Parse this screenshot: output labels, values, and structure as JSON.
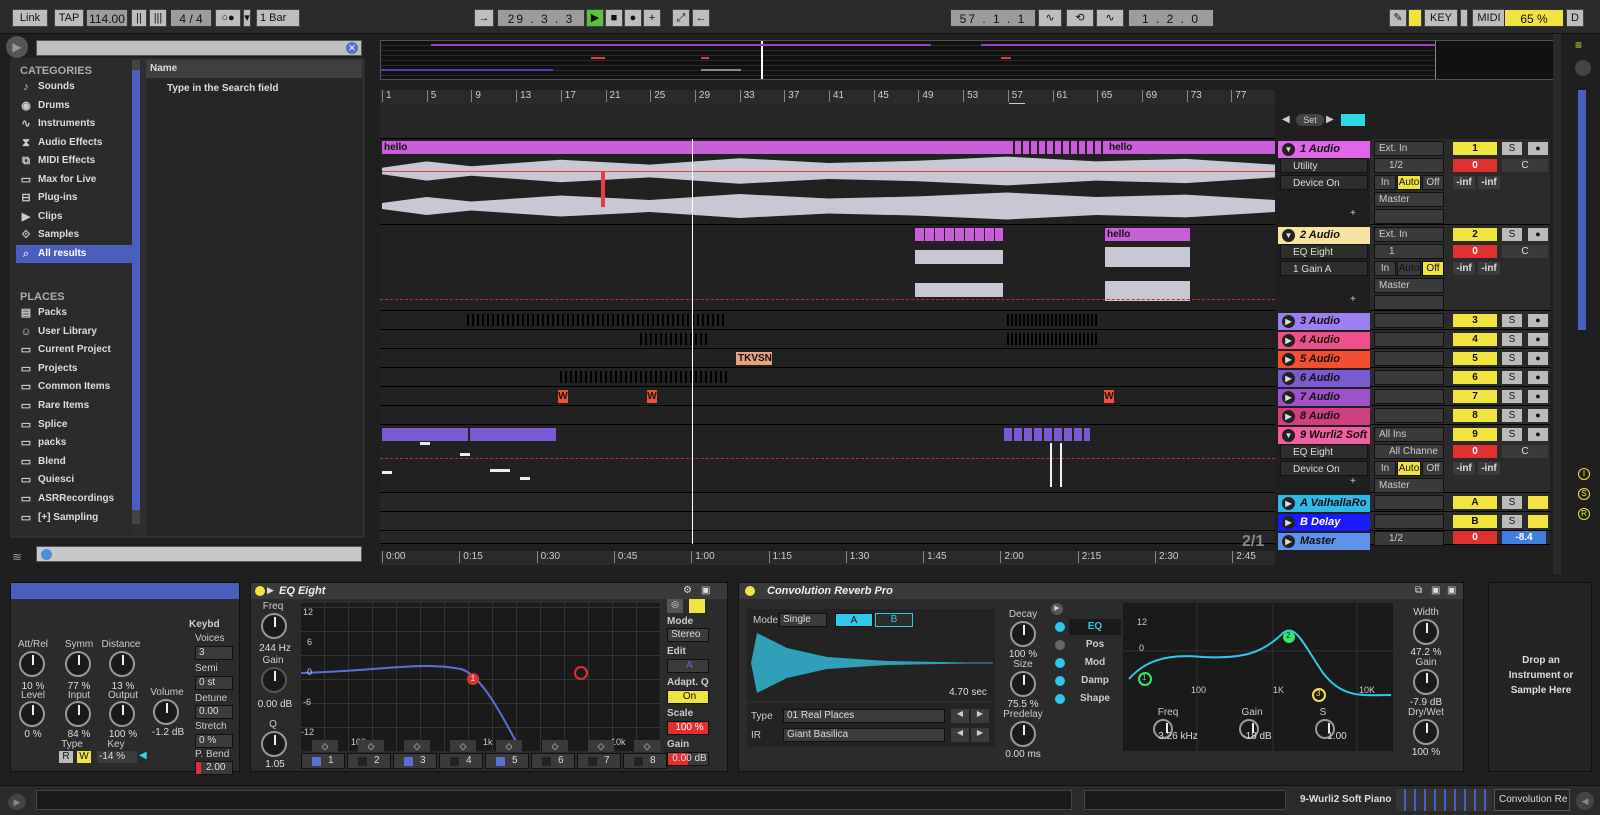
{
  "transport": {
    "link": "Link",
    "tap": "TAP",
    "tempo": "114.00",
    "signature": "4 / 4",
    "quantize": "1 Bar",
    "position": "29 .  3 .  3",
    "loop_start": "57 .  1 .  1",
    "loop_length": "1 .  2 .  0",
    "key": "KEY",
    "midi": "MIDI",
    "cpu": "65 %",
    "d": "D"
  },
  "browser": {
    "search_placeholder": "",
    "categories_title": "CATEGORIES",
    "name_header": "Name",
    "hint": "Type in the Search field",
    "categories": [
      {
        "label": "Sounds",
        "icon": "music-note-icon"
      },
      {
        "label": "Drums",
        "icon": "drum-icon"
      },
      {
        "label": "Instruments",
        "icon": "instrument-icon"
      },
      {
        "label": "Audio Effects",
        "icon": "audio-effect-icon"
      },
      {
        "label": "MIDI Effects",
        "icon": "midi-effect-icon"
      },
      {
        "label": "Max for Live",
        "icon": "max-icon"
      },
      {
        "label": "Plug-ins",
        "icon": "plugin-icon"
      },
      {
        "label": "Clips",
        "icon": "clip-icon"
      },
      {
        "label": "Samples",
        "icon": "sample-icon"
      },
      {
        "label": "All results",
        "icon": "search-icon"
      }
    ],
    "places_title": "PLACES",
    "places": [
      "Packs",
      "User Library",
      "Current Project",
      "Projects",
      "Common Items",
      "Rare Items",
      "Splice",
      "packs",
      "Blend",
      "Quiesci",
      "ASRRecordings",
      "[+] Sampling"
    ]
  },
  "ruler": {
    "bars": [
      "1",
      "5",
      "9",
      "13",
      "17",
      "21",
      "25",
      "29",
      "33",
      "37",
      "41",
      "45",
      "49",
      "53",
      "57",
      "61",
      "65",
      "69",
      "73",
      "77"
    ],
    "times": [
      "0:00",
      "0:15",
      "0:30",
      "0:45",
      "1:00",
      "1:15",
      "1:30",
      "1:45",
      "2:00",
      "2:15",
      "2:30",
      "2:45"
    ],
    "set_label": "Set",
    "zoom": "2/1"
  },
  "clips": {
    "hello": "hello",
    "tkvsn": "TKVSN",
    "w": "W",
    "h": "h",
    "he": "he",
    "hell": "hello"
  },
  "tracks": [
    {
      "name": "1 Audio",
      "color": "#e066e8",
      "num": "1",
      "input": "Ext. In",
      "chan": "1/2",
      "monitor_in": "In",
      "auto": "Auto",
      "off": "Off",
      "out": "Master",
      "vol": "0",
      "pan": "C",
      "inf1": "-inf",
      "inf2": "-inf",
      "devices": [
        "Utility",
        "Device On"
      ]
    },
    {
      "name": "2 Audio",
      "color": "#f7e4a0",
      "num": "2",
      "input": "Ext. In",
      "chan": "1",
      "monitor_in": "In",
      "auto": "Auto",
      "off": "Off",
      "out": "Master",
      "vol": "0",
      "pan": "C",
      "inf1": "-inf",
      "inf2": "-inf",
      "devices": [
        "EQ Eight",
        "1 Gain A"
      ]
    },
    {
      "name": "3 Audio",
      "color": "#9a80f0",
      "num": "3"
    },
    {
      "name": "4 Audio",
      "color": "#f0508a",
      "num": "4"
    },
    {
      "name": "5 Audio",
      "color": "#f05030",
      "num": "5"
    },
    {
      "name": "6 Audio",
      "color": "#7a5ad0",
      "num": "6"
    },
    {
      "name": "7 Audio",
      "color": "#a050c8",
      "num": "7"
    },
    {
      "name": "8 Audio",
      "color": "#d04080",
      "num": "8"
    },
    {
      "name": "9 Wurli2 Soft",
      "color": "#f060a0",
      "num": "9",
      "input": "All Ins",
      "chan": "All Channe",
      "monitor_in": "In",
      "auto": "Auto",
      "off": "Off",
      "out": "Master",
      "vol": "0",
      "pan": "C",
      "inf1": "-inf",
      "inf2": "-inf",
      "devices": [
        "EQ Eight",
        "Device On"
      ]
    },
    {
      "name": "A ValhallaRo",
      "color": "#30b8e8",
      "num": "A"
    },
    {
      "name": "B Delay",
      "color": "#1a1aff",
      "num": "B"
    },
    {
      "name": "Master",
      "color": "#5f95e8",
      "num": "",
      "chan": "1/2",
      "vol": "0",
      "vol2": "-8.4"
    }
  ],
  "instrument_panel": {
    "labels": {
      "attrel": "Att/Rel",
      "symm": "Symm",
      "distance": "Distance",
      "level": "Level",
      "input": "Input",
      "output": "Output",
      "volume": "Volume",
      "type": "Type",
      "key": "Key",
      "keybd": "Keybd",
      "voices": "Voices",
      "semi": "Semi",
      "detune": "Detune",
      "stretch": "Stretch",
      "pbend": "P. Bend"
    },
    "values": {
      "attrel": "10 %",
      "symm": "77 %",
      "distance": "13 %",
      "level": "0 %",
      "input": "84 %",
      "output": "100 %",
      "volume": "-1.2 dB",
      "type_r": "R",
      "type_w": "W",
      "key": "-14 %",
      "voices": "3",
      "semi": "0 st",
      "detune": "0.00",
      "stretch": "0 %",
      "pbend": "2.00"
    }
  },
  "eq_eight": {
    "title": "EQ Eight",
    "freq_label": "Freq",
    "freq": "244 Hz",
    "gain_label": "Gain",
    "gain": "0.00 dB",
    "q_label": "Q",
    "q": "1.05",
    "db_ticks": [
      "12",
      "6",
      "0",
      "-6",
      "-12"
    ],
    "freq_ticks": [
      "100",
      "1k",
      "10k"
    ],
    "bands": [
      "1",
      "2",
      "3",
      "4",
      "5",
      "6",
      "7",
      "8"
    ],
    "mode_label": "Mode",
    "mode": "Stereo",
    "edit_label": "Edit",
    "edit": "A",
    "adaptq_label": "Adapt. Q",
    "adaptq": "On",
    "scale_label": "Scale",
    "scale": "100 %",
    "outgain_label": "Gain",
    "outgain": "0.00 dB"
  },
  "reverb": {
    "title": "Convolution Reverb Pro",
    "mode_label": "Mode",
    "mode": "Single",
    "a": "A",
    "b": "B",
    "length": "4.70 sec",
    "type_label": "Type",
    "type": "01 Real Places",
    "ir_label": "IR",
    "ir": "Giant Basilica",
    "decay_label": "Decay",
    "decay": "100 %",
    "size_label": "Size",
    "size": "75.5 %",
    "predelay_label": "Predelay",
    "predelay": "0.00 ms",
    "tabs": [
      "EQ",
      "Pos",
      "Mod",
      "Damp",
      "Shape"
    ],
    "eq_ticks": [
      "12",
      "0",
      "100",
      "1K",
      "10K"
    ],
    "freq_label": "Freq",
    "freq": "3.26 kHz",
    "gain_label": "Gain",
    "gain": "-18 dB",
    "s_label": "S",
    "s": "1.00",
    "width_label": "Width",
    "width": "47.2 %",
    "gain2_label": "Gain",
    "gain2": "-7.9 dB",
    "drywet_label": "Dry/Wet",
    "drywet": "100 %",
    "nodes": [
      "1",
      "2",
      "3"
    ]
  },
  "drop_zone": "Drop an Instrument or Sample Here",
  "status": {
    "selected": "9-Wurli2 Soft Piano",
    "device": "Convolution Re"
  }
}
